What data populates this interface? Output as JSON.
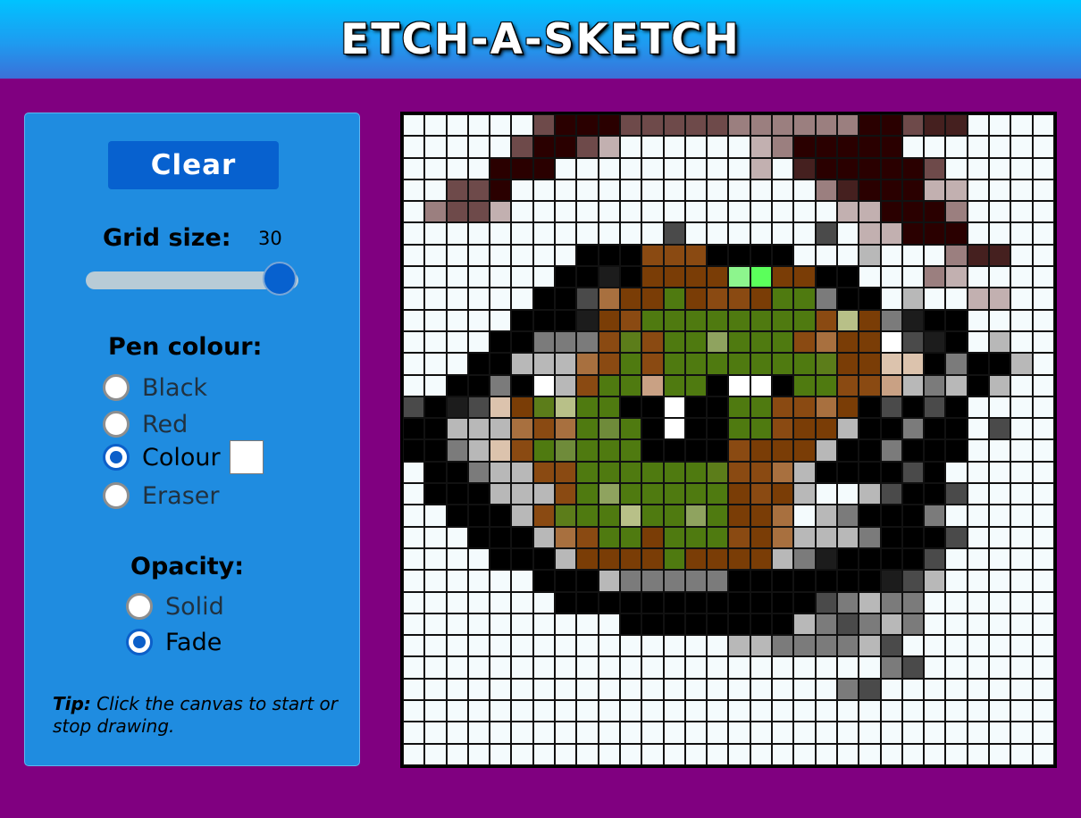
{
  "header": {
    "title": "ETCH-A-SKETCH"
  },
  "panel": {
    "clear_label": "Clear",
    "grid_size_label": "Grid size:",
    "grid_size_value": "30",
    "pen_colour_label": "Pen colour:",
    "pen_options": [
      {
        "label": "Black",
        "checked": false
      },
      {
        "label": "Red",
        "checked": false
      },
      {
        "label": "Colour",
        "checked": true
      },
      {
        "label": "Eraser",
        "checked": false
      }
    ],
    "selected_colour": "#ffffff",
    "opacity_label": "Opacity:",
    "opacity_options": [
      {
        "label": "Solid",
        "checked": false
      },
      {
        "label": "Fade",
        "checked": true
      }
    ],
    "tip_bold": "Tip:",
    "tip_text": " Click the canvas to start or stop drawing."
  },
  "canvas": {
    "grid_size": 30,
    "palette": {
      ".": "#f4fbfd",
      "K": "#000000",
      "k": "#1c1c1c",
      "g": "#4a4a4a",
      "m": "#7b7b7b",
      "n": "#9e9e9e",
      "s": "#b8b8b8",
      "w": "#ffffff",
      "D": "#2a0000",
      "d": "#45201f",
      "r": "#6e4a4a",
      "p": "#9b7f7f",
      "q": "#c2b0b0",
      "B": "#7a3d06",
      "b": "#8a4a12",
      "t": "#a8703f",
      "c": "#c9a184",
      "e": "#dcc3ad",
      "G": "#4f7a10",
      "h": "#5c7d1a",
      "o": "#6f8b3a",
      "l": "#8fa35f",
      "y": "#b8c088",
      "L": "#5bff5b",
      "M": "#8df58d"
    },
    "rows": [
      "......rDDDrrrrrppppppDDrdd....",
      ".....rDDrq......qpDDDDD.......",
      "....DDD.........q.dDDDDDr.....",
      "..rrD..............pdDDDqq....",
      ".prrq...............qqDDDp....",
      "............g......g.qqDDD....",
      "........KKKbbbKKKK...s...pdd..",
      ".......KKkKBBBBMLBBKK...pq....",
      "......KKgtBBGBbbBGGmKK.s..qq..",
      ".....KKKkBbGGGGGGGGbyBmkKK....",
      "....KKmmmbhbGGlGGGbtBBwgkK.s..",
      "...KKssstbGbGGGGGGGhBBeeKmKKs.",
      "..KKmKwsbGGcGGKwwKGGbbcsmsKs..",
      "gKkgeBhyGGKKwKKGGbbtBKgKgK....",
      "KKssstbtGoGKwKKGGbBBsKKmKK.g..",
      "KKmsebGoGGGKKKKbBBBsKKmKKK....",
      ".KKmssbbGGGGGGhbbtsKKKKgK.....",
      ".KKKsssbGlGGGGGBbBs..sgKKg....",
      "..KKKsbhGGyGGlGBBt.smKKKm.....",
      "...KKKstbGGBGGGbBtsssmKKKg....",
      "....KKKsBBBBGBBBBsmkKKKKg.....",
      "......KKKsmmmmmKKKKKKKkgs.....",
      ".......KKKKKKKKKKKKgmsmm......",
      "..........KKKKKKKKsmgmsm......",
      "...............ssmmmmsg.......",
      "......................mg......",
      "....................mg........",
      "...........................",
      "..............................",
      ".............................."
    ]
  }
}
